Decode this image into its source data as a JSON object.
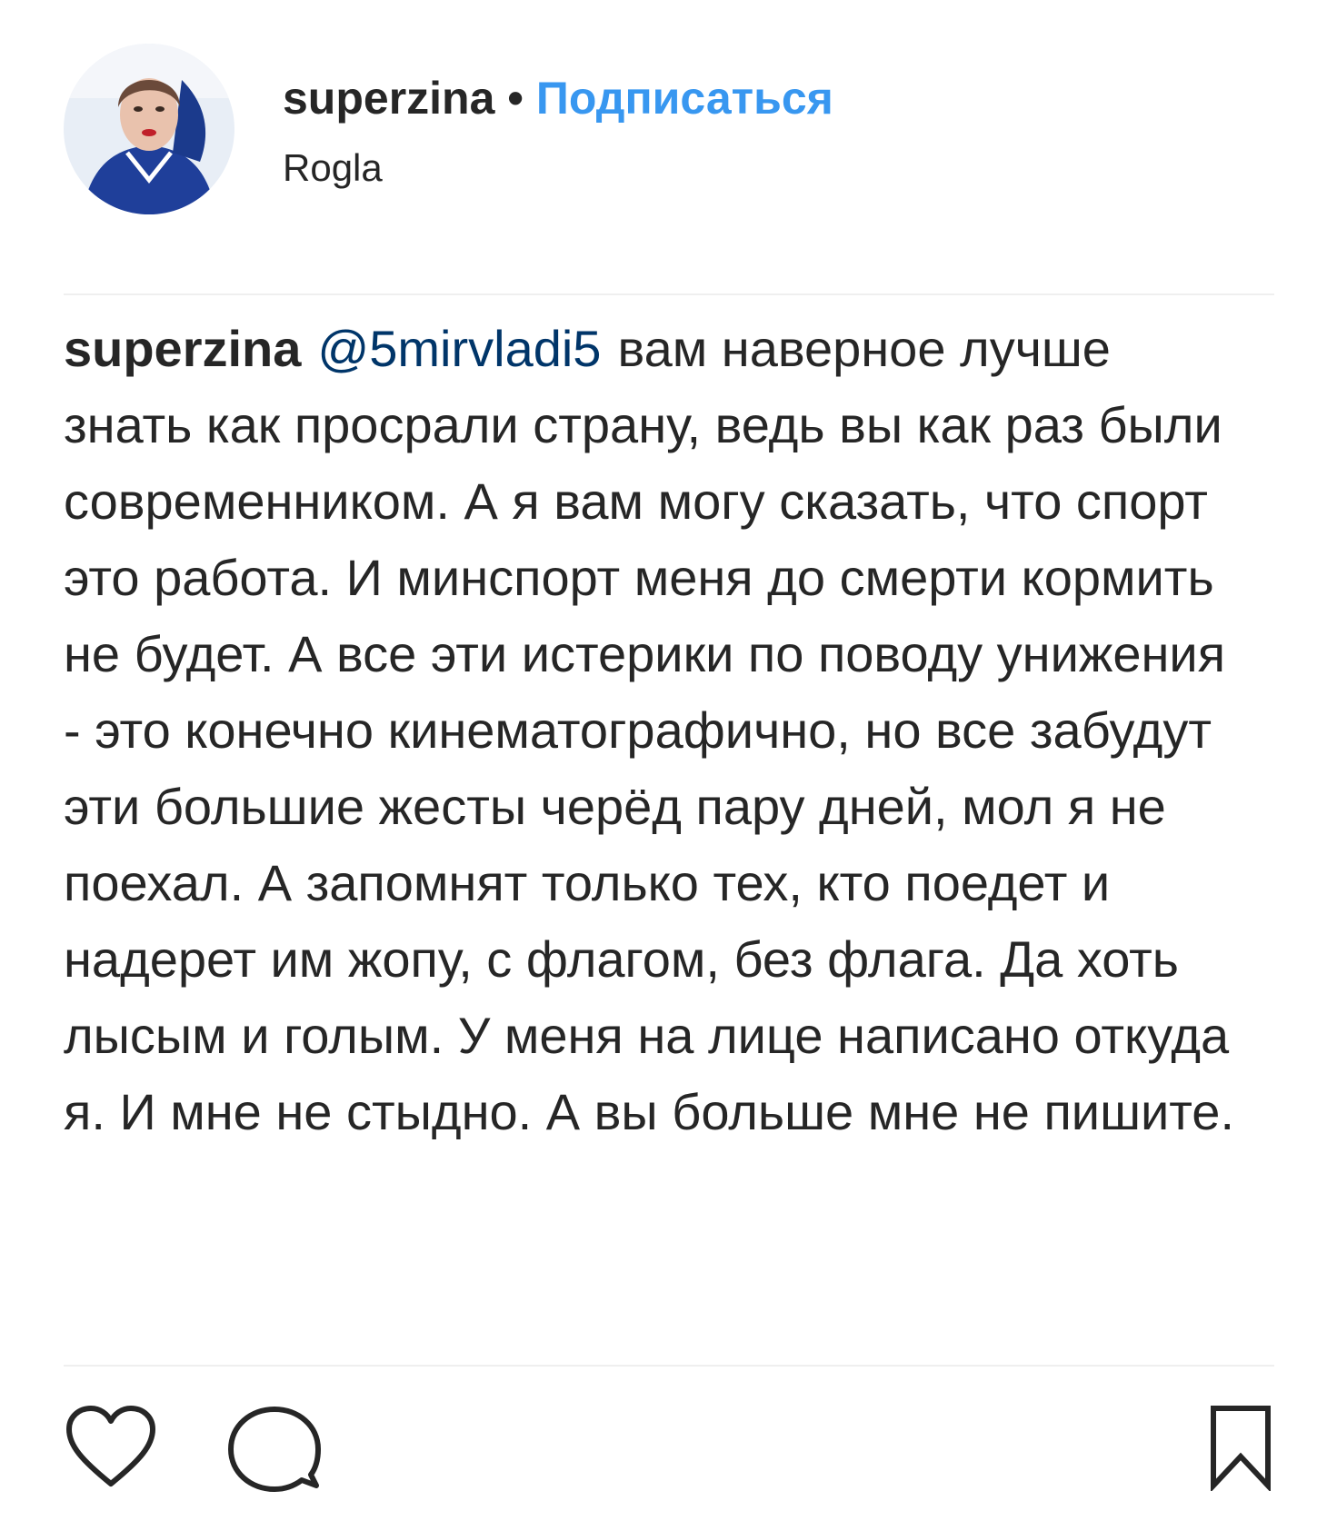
{
  "header": {
    "username": "superzina",
    "separator": "•",
    "follow_label": "Подписаться",
    "location": "Rogla"
  },
  "comment": {
    "username": "superzina",
    "mention": "@5mirvladi5",
    "text": "вам наверное лучше знать как просрали страну, ведь вы как раз были современником. А я вам могу сказать, что спорт это работа. И минспорт меня до смерти кормить не будет. А все эти истерики по поводу унижения - это конечно кинематографично, но все забудут эти большие жесты черёд пару дней, мол я не поехал. А запомнят только тех, кто поедет и надерет им жопу, с флагом, без флага. Да хоть лысым и голым. У меня на лице написано откуда я. И мне не стыдно. А вы больше мне не пишите."
  },
  "actions": {
    "like_icon": "heart-icon",
    "comment_icon": "speech-bubble-icon",
    "save_icon": "bookmark-icon"
  },
  "colors": {
    "text": "#262626",
    "follow": "#3897f0",
    "mention": "#003569",
    "divider": "#efefef"
  }
}
